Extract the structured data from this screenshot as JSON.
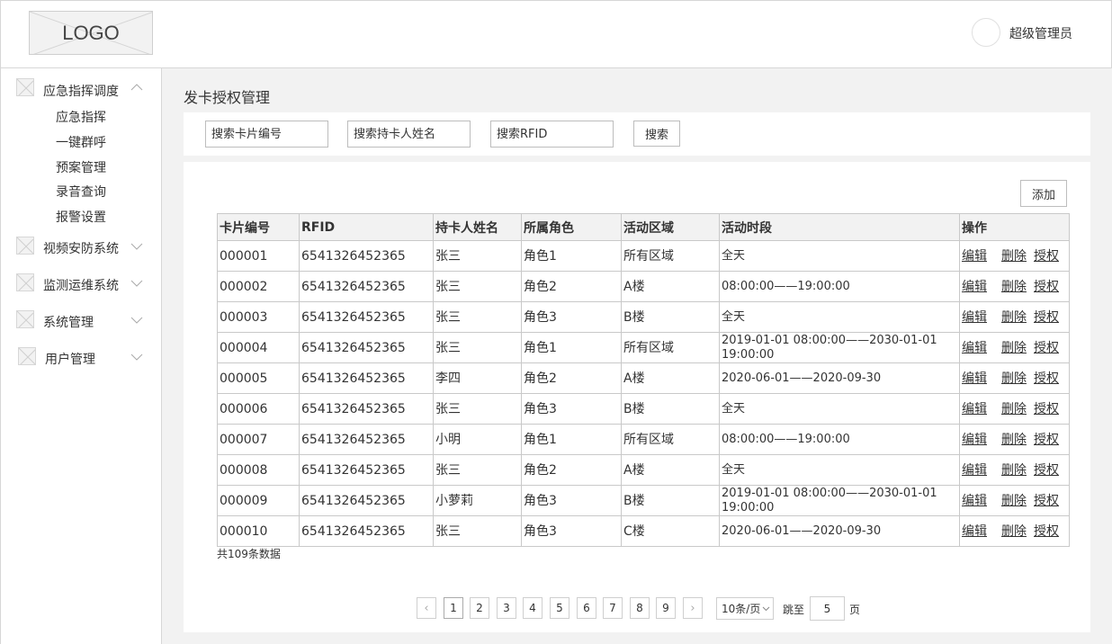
{
  "header": {
    "logo_text": "LOGO",
    "user_name": "超级管理员"
  },
  "sidebar": {
    "groups": [
      {
        "label": "应急指挥调度",
        "expanded": true,
        "items": [
          "应急指挥",
          "一键群呼",
          "预案管理",
          "录音查询",
          "报警设置"
        ]
      },
      {
        "label": "视频安防系统",
        "expanded": false
      },
      {
        "label": "监测运维系统",
        "expanded": false
      },
      {
        "label": "系统管理",
        "expanded": false
      },
      {
        "label": "用户管理",
        "expanded": false
      }
    ]
  },
  "main": {
    "title": "发卡授权管理",
    "search": {
      "card_no_placeholder": "搜索卡片编号",
      "holder_placeholder": "搜索持卡人姓名",
      "rfid_placeholder": "搜索RFID",
      "button": "搜索"
    },
    "add_button": "添加",
    "table": {
      "columns": [
        "卡片编号",
        "RFID",
        "持卡人姓名",
        "所属角色",
        "活动区域",
        "活动时段",
        "操作"
      ],
      "actions": [
        "编辑",
        "删除",
        "授权"
      ],
      "rows": [
        [
          "000001",
          "6541326452365",
          "张三",
          "角色1",
          "所有区域",
          "全天"
        ],
        [
          "000002",
          "6541326452365",
          "张三",
          "角色2",
          "A楼",
          "08:00:00——19:00:00"
        ],
        [
          "000003",
          "6541326452365",
          "张三",
          "角色3",
          "B楼",
          "全天"
        ],
        [
          "000004",
          "6541326452365",
          "张三",
          "角色1",
          "所有区域",
          "2019-01-01 08:00:00——2030-01-01 19:00:00"
        ],
        [
          "000005",
          "6541326452365",
          "李四",
          "角色2",
          "A楼",
          "2020-06-01——2020-09-30"
        ],
        [
          "000006",
          "6541326452365",
          "张三",
          "角色3",
          "B楼",
          "全天"
        ],
        [
          "000007",
          "6541326452365",
          "小明",
          "角色1",
          "所有区域",
          "08:00:00——19:00:00"
        ],
        [
          "000008",
          "6541326452365",
          "张三",
          "角色2",
          "A楼",
          "全天"
        ],
        [
          "000009",
          "6541326452365",
          "小萝莉",
          "角色3",
          "B楼",
          "2019-01-01 08:00:00——2030-01-01 19:00:00"
        ],
        [
          "000010",
          "6541326452365",
          "张三",
          "角色3",
          "C楼",
          "2020-06-01——2020-09-30"
        ]
      ]
    },
    "total_text": "共109条数据",
    "pagination": {
      "prev": "‹",
      "next": "›",
      "pages": [
        "1",
        "2",
        "3",
        "4",
        "5",
        "6",
        "7",
        "8",
        "9"
      ],
      "current": "1",
      "page_size": "10条/页",
      "jump_label": "跳至",
      "jump_value": "5",
      "jump_unit": "页"
    }
  }
}
